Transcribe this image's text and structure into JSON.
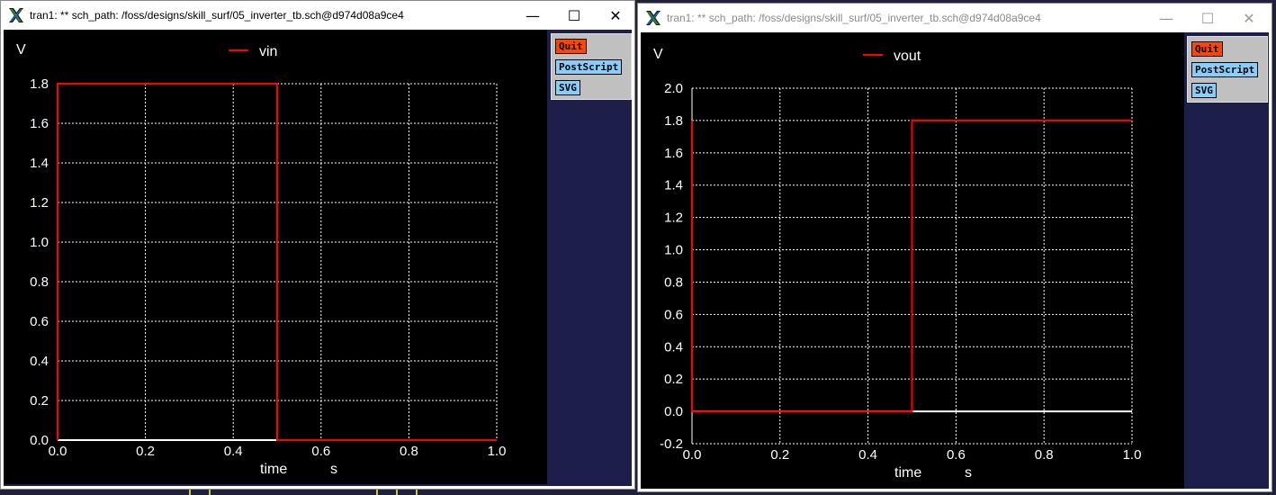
{
  "windows": [
    {
      "title": "tran1: ** sch_path: /foss/designs/skill_surf/05_inverter_tb.sch@d974d08a9ce4",
      "state": "active",
      "controls": {
        "minimize": "—",
        "maximize": "☐",
        "close": "✕"
      },
      "buttons": {
        "quit": "Quit",
        "postscript": "PostScript",
        "svg": "SVG"
      },
      "chart_data": {
        "type": "line",
        "ylabel": "V",
        "xlabel": "time",
        "xunit": "s",
        "legend_placement": "top-center",
        "grid": true,
        "xlim": [
          0,
          1.0
        ],
        "ylim": [
          0,
          1.8
        ],
        "x_ticks": [
          "0.0",
          "0.2",
          "0.4",
          "0.6",
          "0.8",
          "1.0"
        ],
        "y_ticks": [
          "0.0",
          "0.2",
          "0.4",
          "0.6",
          "0.8",
          "1.0",
          "1.2",
          "1.4",
          "1.6",
          "1.8"
        ],
        "series": [
          {
            "name": "vin",
            "color": "#ff0000",
            "x": [
              0.0,
              0.0,
              0.5,
              0.5,
              1.0
            ],
            "y": [
              0.0,
              1.8,
              1.8,
              0.0,
              0.0
            ]
          }
        ]
      }
    },
    {
      "title": "tran1: ** sch_path: /foss/designs/skill_surf/05_inverter_tb.sch@d974d08a9ce4",
      "state": "inactive",
      "controls": {
        "minimize": "—",
        "maximize": "☐",
        "close": "✕"
      },
      "buttons": {
        "quit": "Quit",
        "postscript": "PostScript",
        "svg": "SVG"
      },
      "chart_data": {
        "type": "line",
        "ylabel": "V",
        "xlabel": "time",
        "xunit": "s",
        "legend_placement": "top-center",
        "grid": true,
        "xlim": [
          0,
          1.0
        ],
        "ylim": [
          -0.2,
          2.0
        ],
        "x_ticks": [
          "0.0",
          "0.2",
          "0.4",
          "0.6",
          "0.8",
          "1.0"
        ],
        "y_ticks": [
          "-0.2",
          "0.0",
          "0.2",
          "0.4",
          "0.6",
          "0.8",
          "1.0",
          "1.2",
          "1.4",
          "1.6",
          "1.8",
          "2.0"
        ],
        "series": [
          {
            "name": "vout",
            "color": "#ff0000",
            "x": [
              0.0,
              0.0,
              0.5,
              0.5,
              1.0
            ],
            "y": [
              1.8,
              0.0,
              0.0,
              1.8,
              1.8
            ]
          }
        ]
      }
    }
  ],
  "colors": {
    "accent_quit": "#ff4500",
    "accent_button": "#87cefa",
    "trace": "#ff0000",
    "plot_bg": "#000000",
    "grid": "#ffffff"
  }
}
